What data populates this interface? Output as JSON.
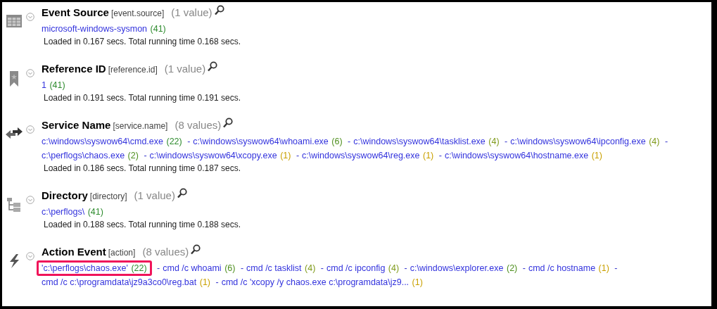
{
  "separator": "-",
  "sections": [
    {
      "kind": "table",
      "title": "Event Source",
      "field": "[event.source]",
      "count": "(1 value)",
      "values": [
        {
          "text": "microsoft-windows-sysmon",
          "count": "(41)",
          "color": "#2e8b2e",
          "highlighted": false
        }
      ],
      "timing": "Loaded in 0.167 secs. Total running time 0.168 secs."
    },
    {
      "kind": "bookmark",
      "title": "Reference ID",
      "field": "[reference.id]",
      "count": "(1 value)",
      "values": [
        {
          "text": "1",
          "count": "(41)",
          "color": "#2e8b2e",
          "highlighted": false
        }
      ],
      "timing": "Loaded in 0.191 secs. Total running time 0.191 secs."
    },
    {
      "kind": "arrows",
      "title": "Service Name",
      "field": "[service.name]",
      "count": "(8 values)",
      "values": [
        {
          "text": "c:\\windows\\syswow64\\cmd.exe",
          "count": "(22)",
          "color": "#2e8b2e",
          "highlighted": false
        },
        {
          "text": "c:\\windows\\syswow64\\whoami.exe",
          "count": "(6)",
          "color": "#4e8f1e",
          "highlighted": false
        },
        {
          "text": "c:\\windows\\syswow64\\tasklist.exe",
          "count": "(4)",
          "color": "#7f9a1a",
          "highlighted": false
        },
        {
          "text": "c:\\windows\\syswow64\\ipconfig.exe",
          "count": "(4)",
          "color": "#7f9a1a",
          "highlighted": false
        },
        {
          "text": "c:\\perflogs\\chaos.exe",
          "count": "(2)",
          "color": "#4e8f1e",
          "highlighted": false
        },
        {
          "text": "c:\\windows\\syswow64\\xcopy.exe",
          "count": "(1)",
          "color": "#c9a000",
          "highlighted": false
        },
        {
          "text": "c:\\windows\\syswow64\\reg.exe",
          "count": "(1)",
          "color": "#c9a000",
          "highlighted": false
        },
        {
          "text": "c:\\windows\\syswow64\\hostname.exe",
          "count": "(1)",
          "color": "#c9a000",
          "highlighted": false
        }
      ],
      "timing": "Loaded in 0.186 secs. Total running time 0.187 secs."
    },
    {
      "kind": "tree",
      "title": "Directory",
      "field": "[directory]",
      "count": "(1 value)",
      "values": [
        {
          "text": "c:\\perflogs\\",
          "count": "(41)",
          "color": "#2e8b2e",
          "highlighted": false
        }
      ],
      "timing": "Loaded in 0.188 secs. Total running time 0.188 secs."
    },
    {
      "kind": "bolt",
      "title": "Action Event",
      "field": "[action]",
      "count": "(8 values)",
      "values": [
        {
          "text": "'c:\\perflogs\\chaos.exe'",
          "count": "(22)",
          "color": "#2e8b2e",
          "highlighted": true
        },
        {
          "text": "cmd /c whoami",
          "count": "(6)",
          "color": "#4e8f1e",
          "highlighted": false
        },
        {
          "text": "cmd /c tasklist",
          "count": "(4)",
          "color": "#7f9a1a",
          "highlighted": false
        },
        {
          "text": "cmd /c ipconfig",
          "count": "(4)",
          "color": "#7f9a1a",
          "highlighted": false
        },
        {
          "text": "c:\\windows\\explorer.exe",
          "count": "(2)",
          "color": "#4e8f1e",
          "highlighted": false
        },
        {
          "text": "cmd /c hostname",
          "count": "(1)",
          "color": "#c9a000",
          "highlighted": false
        },
        {
          "text": "cmd /c c:\\programdata\\jz9a3co0\\reg.bat",
          "count": "(1)",
          "color": "#c9a000",
          "highlighted": false
        },
        {
          "text": "cmd /c 'xcopy /y chaos.exe c:\\programdata\\jz9...",
          "count": "(1)",
          "color": "#c9a000",
          "highlighted": false
        }
      ]
    }
  ]
}
